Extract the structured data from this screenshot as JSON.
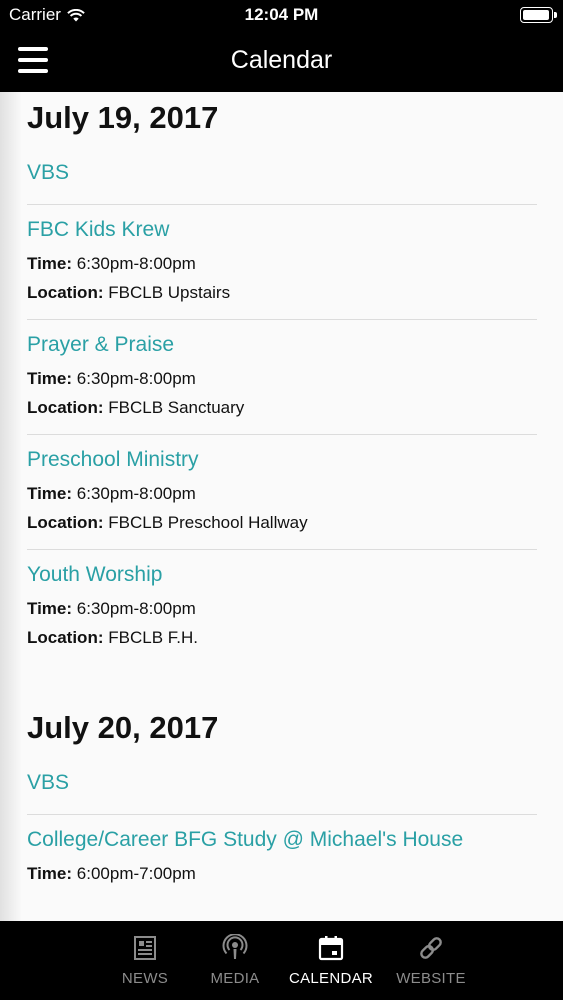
{
  "status_bar": {
    "carrier": "Carrier",
    "time": "12:04 PM",
    "battery_level": 0.95
  },
  "nav": {
    "title": "Calendar"
  },
  "days": [
    {
      "date": "July 19, 2017",
      "events": [
        {
          "title": "VBS"
        },
        {
          "title": "FBC Kids Krew",
          "time_label": "Time:",
          "time": "6:30pm-8:00pm",
          "location_label": "Location:",
          "location": "FBCLB Upstairs"
        },
        {
          "title": "Prayer & Praise",
          "time_label": "Time:",
          "time": "6:30pm-8:00pm",
          "location_label": "Location:",
          "location": "FBCLB Sanctuary"
        },
        {
          "title": "Preschool Ministry",
          "time_label": "Time:",
          "time": "6:30pm-8:00pm",
          "location_label": "Location:",
          "location": "FBCLB Preschool Hallway"
        },
        {
          "title": "Youth Worship",
          "time_label": "Time:",
          "time": "6:30pm-8:00pm",
          "location_label": "Location:",
          "location": "FBCLB F.H."
        }
      ]
    },
    {
      "date": "July 20, 2017",
      "events": [
        {
          "title": "VBS"
        },
        {
          "title": "College/Career BFG Study @ Michael's House",
          "time_label": "Time:",
          "time": "6:00pm-7:00pm"
        }
      ]
    }
  ],
  "tabs": [
    {
      "label": "NEWS",
      "icon": "news-icon",
      "active": false
    },
    {
      "label": "MEDIA",
      "icon": "podcast-icon",
      "active": false
    },
    {
      "label": "CALENDAR",
      "icon": "calendar-icon",
      "active": true
    },
    {
      "label": "WEBSITE",
      "icon": "link-icon",
      "active": false
    }
  ],
  "colors": {
    "accent": "#2aa0a5",
    "bar_background": "#000000",
    "tab_inactive": "#8c8c8c"
  }
}
